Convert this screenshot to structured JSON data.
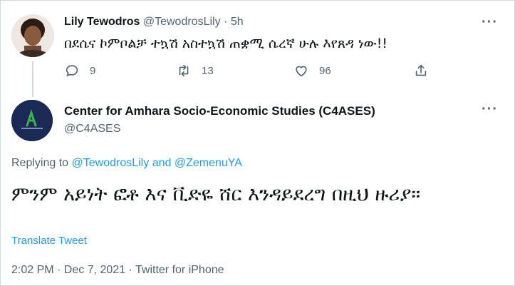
{
  "parent_tweet": {
    "display_name": "Lily Tewodros",
    "handle": "@TewodrosLily",
    "separator": "·",
    "time": "5h",
    "text": "በደሴና ኮምቦልቻ ተኳሽ አስተኳሽ ጠቋሚ ሴረኛ ሁሉ እየጸዳ ነው!!",
    "actions": {
      "replies": "9",
      "retweets": "13",
      "likes": "96"
    }
  },
  "main_tweet": {
    "display_name": "Center for Amhara Socio-Economic Studies (C4ASES)",
    "handle": "@C4ASES",
    "replying_prefix": "Replying to",
    "reply_handle_1": "@TewodrosLily",
    "reply_and": "and",
    "reply_handle_2": "@ZemenuYA",
    "text": "ምንም አይነት ፎቶ እና ቪድዬ ሸር እንዳይደረግ በዚህ ዙሪያ።",
    "translate_label": "Translate Tweet",
    "meta": "2:02 PM · Dec 7, 2021 · Twitter for iPhone"
  },
  "more_label": "···",
  "colors": {
    "accent": "#1d9bf0",
    "muted": "#536471",
    "text": "#0f1419",
    "border": "#cfd9de"
  },
  "icons": {
    "reply": "speech-bubble-icon",
    "retweet": "retweet-icon",
    "like": "heart-icon",
    "share": "share-icon",
    "more": "more-icon"
  }
}
